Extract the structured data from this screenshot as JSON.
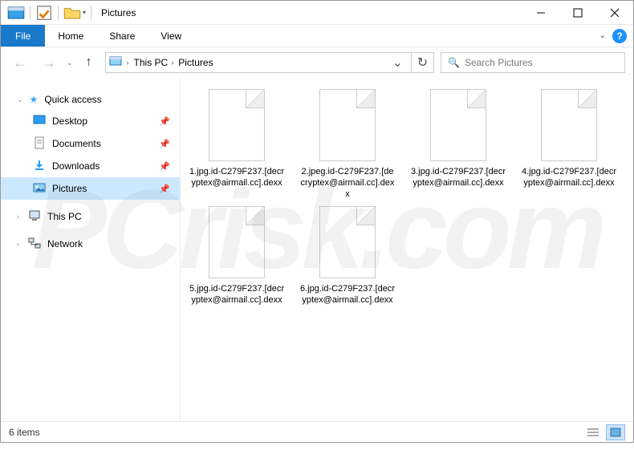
{
  "title": "Pictures",
  "menubar": {
    "file": "File",
    "items": [
      "Home",
      "Share",
      "View"
    ]
  },
  "breadcrumb": {
    "root": "This PC",
    "folder": "Pictures"
  },
  "search": {
    "placeholder": "Search Pictures"
  },
  "sidebar": {
    "quick": "Quick access",
    "items": [
      {
        "label": "Desktop",
        "pinned": true
      },
      {
        "label": "Documents",
        "pinned": true
      },
      {
        "label": "Downloads",
        "pinned": true
      },
      {
        "label": "Pictures",
        "pinned": true,
        "selected": true
      }
    ],
    "thispc": "This PC",
    "network": "Network"
  },
  "files": [
    {
      "name": "1.jpg.id-C279F237.[decryptex@airmail.cc].dexx"
    },
    {
      "name": "2.jpeg.id-C279F237.[decryptex@airmail.cc].dexx"
    },
    {
      "name": "3.jpg.id-C279F237.[decryptex@airmail.cc].dexx"
    },
    {
      "name": "4.jpg.id-C279F237.[decryptex@airmail.cc].dexx"
    },
    {
      "name": "5.jpg.id-C279F237.[decryptex@airmail.cc].dexx"
    },
    {
      "name": "6.jpg.id-C279F237.[decryptex@airmail.cc].dexx"
    }
  ],
  "status": {
    "count": "6 items"
  },
  "watermark": "PCrisk.com"
}
